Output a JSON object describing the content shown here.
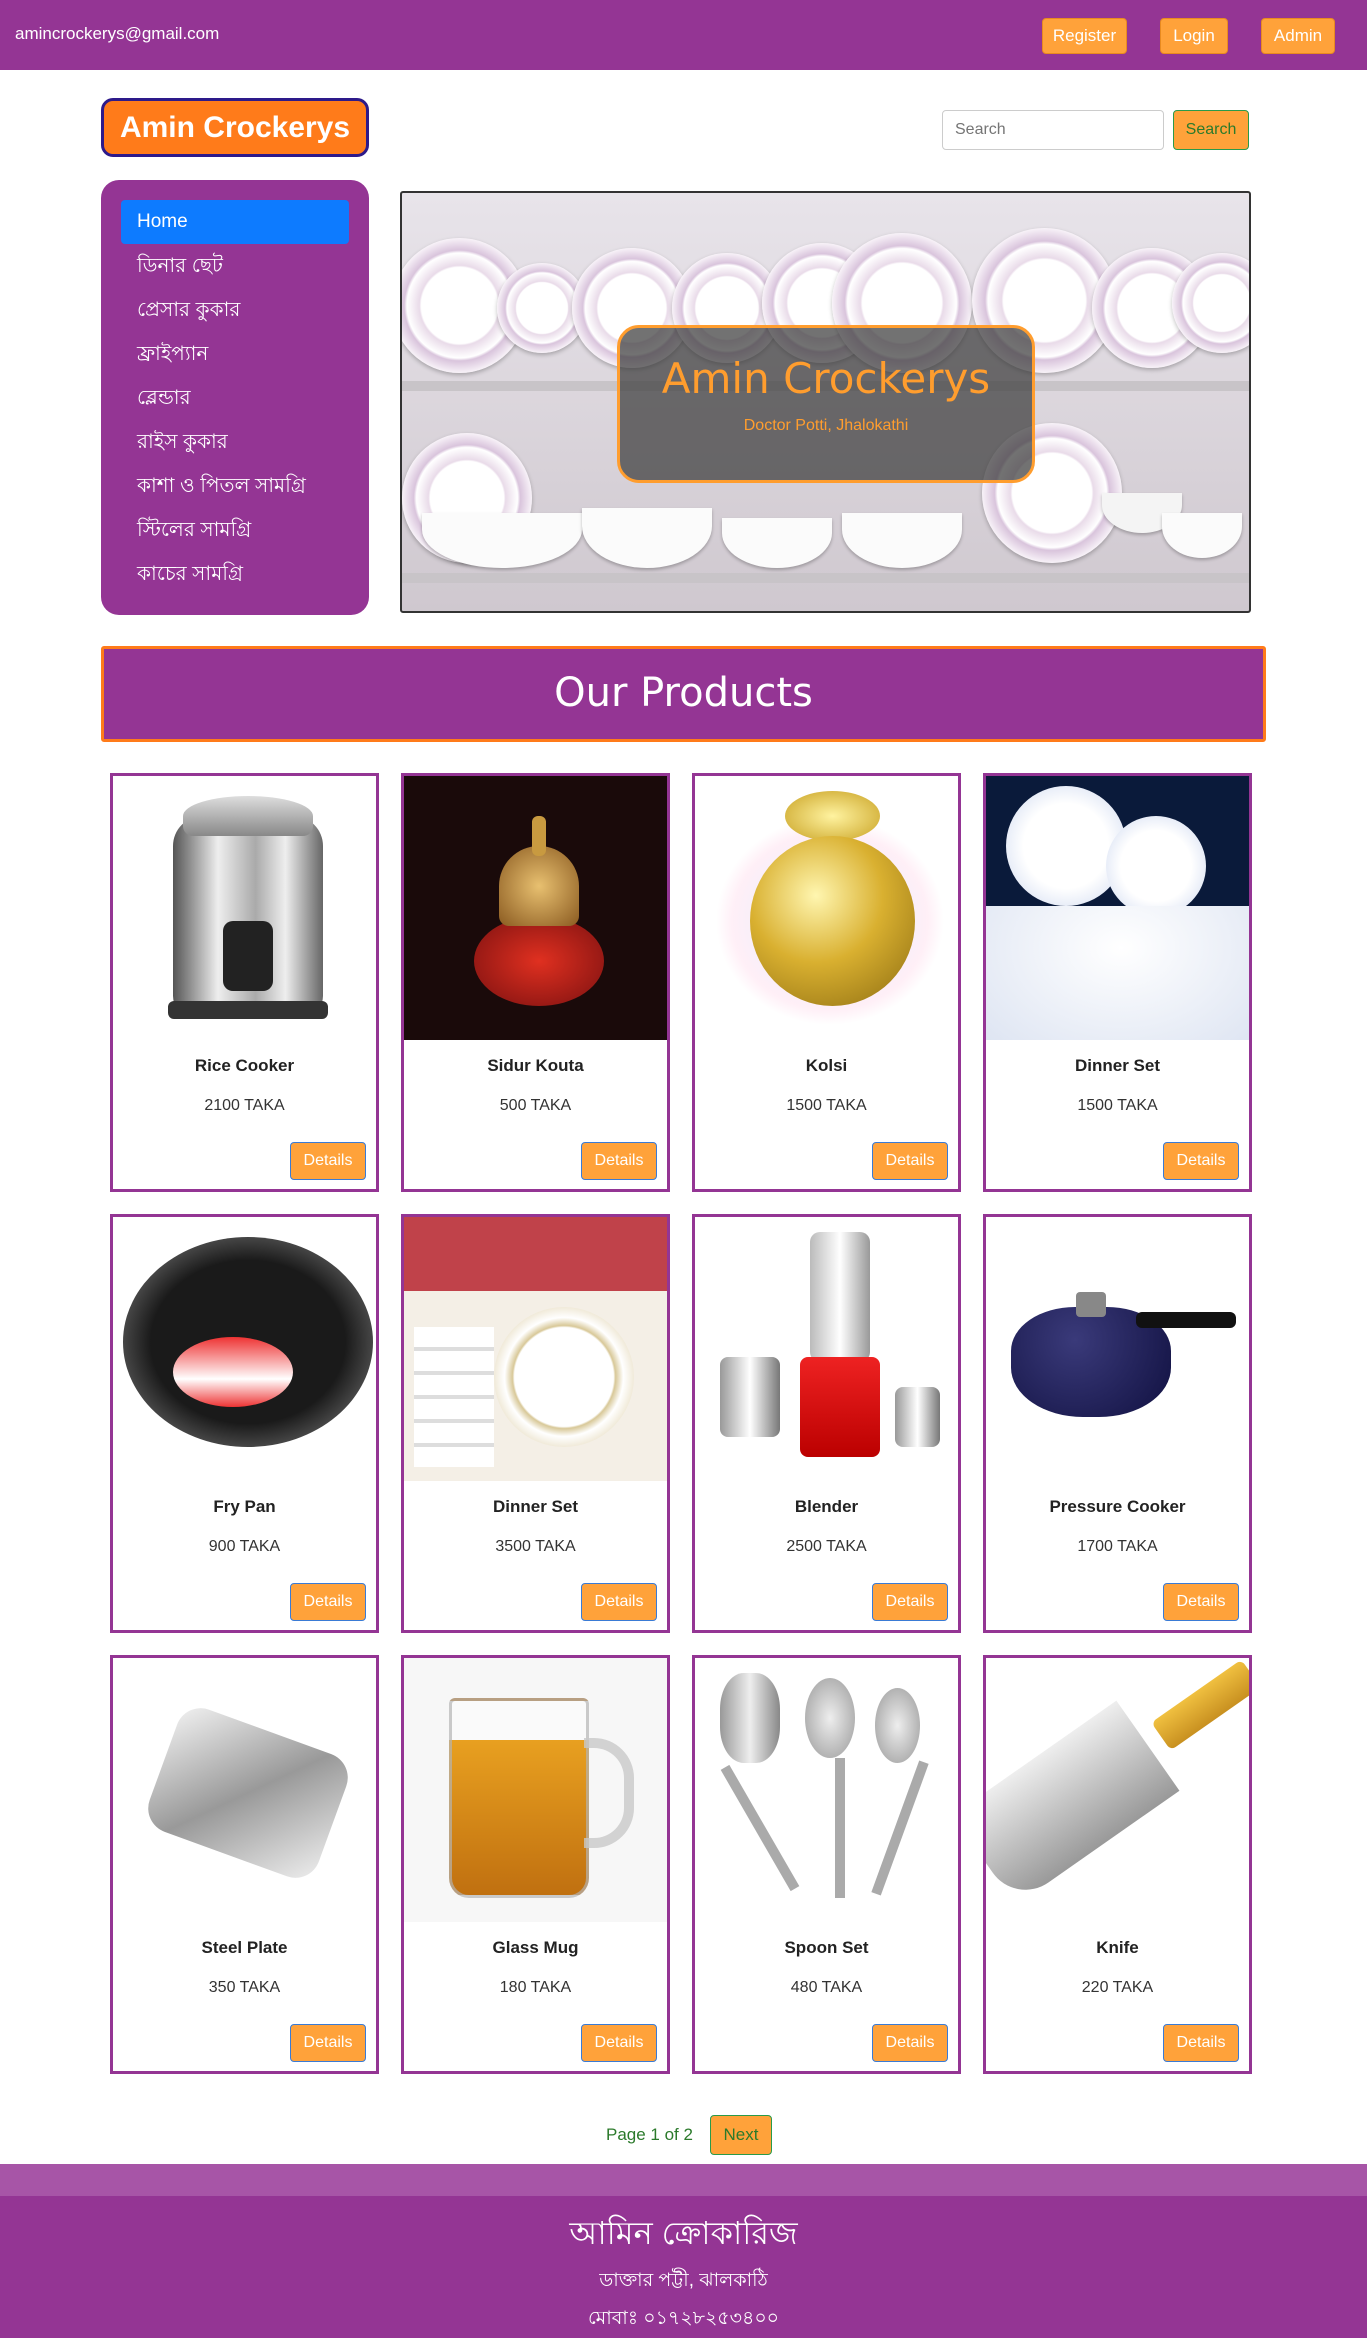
{
  "topbar": {
    "email": "amincrockerys@gmail.com",
    "register": "Register",
    "login": "Login",
    "admin": "Admin"
  },
  "brand": "Amin Crockerys",
  "search": {
    "placeholder": "Search",
    "button": "Search"
  },
  "sidebar": {
    "items": [
      {
        "label": "Home"
      },
      {
        "label": "ডিনার ছেট"
      },
      {
        "label": "প্রেসার কুকার"
      },
      {
        "label": "ফ্রাইপ্যান"
      },
      {
        "label": "ব্লেন্ডার"
      },
      {
        "label": "রাইস কুকার"
      },
      {
        "label": "কাশা ও পিতল সামগ্রি"
      },
      {
        "label": "স্টিলের সামগ্রি"
      },
      {
        "label": "কাচের সামগ্রি"
      }
    ]
  },
  "hero": {
    "title": "Amin Crockerys",
    "subtitle": "Doctor Potti, Jhalokathi"
  },
  "products_heading": "Our Products",
  "products": [
    {
      "name": "Rice Cooker",
      "price": "2100 TAKA",
      "details": "Details",
      "icon": "rice-cooker"
    },
    {
      "name": "Sidur Kouta",
      "price": "500 TAKA",
      "details": "Details",
      "icon": "sidur-kouta"
    },
    {
      "name": "Kolsi",
      "price": "1500 TAKA",
      "details": "Details",
      "icon": "kolsi"
    },
    {
      "name": "Dinner Set",
      "price": "1500 TAKA",
      "details": "Details",
      "icon": "dinner-set"
    },
    {
      "name": "Fry Pan",
      "price": "900 TAKA",
      "details": "Details",
      "icon": "fry-pan"
    },
    {
      "name": "Dinner Set",
      "price": "3500 TAKA",
      "details": "Details",
      "icon": "dinner-set-2"
    },
    {
      "name": "Blender",
      "price": "2500 TAKA",
      "details": "Details",
      "icon": "blender"
    },
    {
      "name": "Pressure Cooker",
      "price": "1700 TAKA",
      "details": "Details",
      "icon": "pressure-cooker"
    },
    {
      "name": "Steel Plate",
      "price": "350 TAKA",
      "details": "Details",
      "icon": "steel-plate"
    },
    {
      "name": "Glass Mug",
      "price": "180 TAKA",
      "details": "Details",
      "icon": "glass-mug"
    },
    {
      "name": "Spoon Set",
      "price": "480 TAKA",
      "details": "Details",
      "icon": "spoon-set"
    },
    {
      "name": "Knife",
      "price": "220 TAKA",
      "details": "Details",
      "icon": "knife"
    }
  ],
  "pager": {
    "info": "Page 1 of 2",
    "next": "Next"
  },
  "footer": {
    "name": "আমিন ক্রোকারিজ",
    "address": "ডাক্তার পট্টী, ঝালকাঠি",
    "phone": "মোবাঃ ০১৭২৮২৫৩৪০০"
  },
  "colors": {
    "primary": "#943594",
    "accent": "#ffa23a",
    "brand_orange": "#ff7b1a",
    "active": "#0d7bff"
  }
}
